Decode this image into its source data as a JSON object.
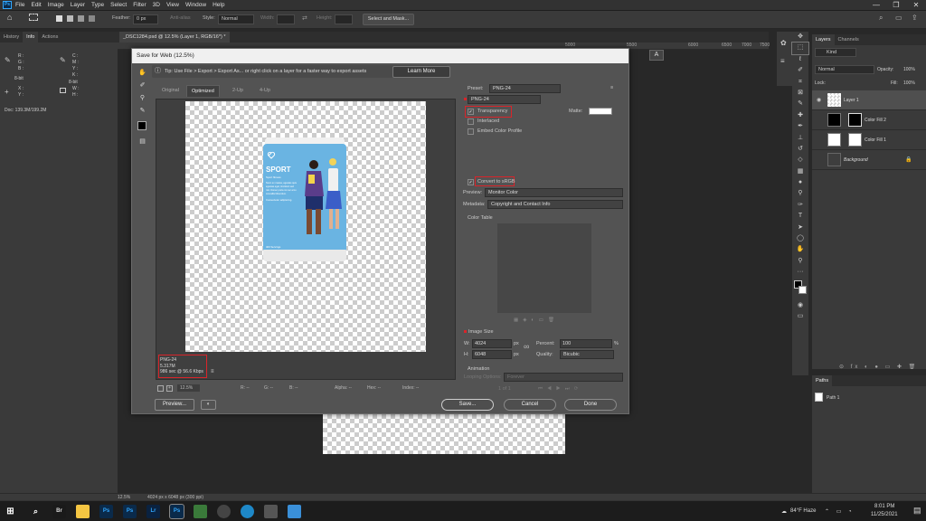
{
  "menubar": {
    "app_icon": "Ps",
    "items": [
      "File",
      "Edit",
      "Image",
      "Layer",
      "Type",
      "Select",
      "Filter",
      "3D",
      "View",
      "Window",
      "Help"
    ]
  },
  "options": {
    "feather_label": "Feather:",
    "feather_value": "0 px",
    "antialias_label": "Anti-alias",
    "style_label": "Style:",
    "style_value": "Normal",
    "width_label": "Width:",
    "height_label": "Height:",
    "select_mask": "Select and Mask..."
  },
  "left_panel": {
    "tabs": [
      "History",
      "Info",
      "Actions"
    ],
    "active_tab": "Info",
    "r": "R :",
    "g": "G :",
    "b": "B :",
    "bit": "8-bit",
    "c": "C :",
    "m": "M :",
    "y": "Y :",
    "k": "K :",
    "bit2": "8-bit",
    "x": "X :",
    "y2": "Y :",
    "w": "W :",
    "h": "H :",
    "doc": "Doc: 139.3M/199.2M"
  },
  "document": {
    "tab": "_DSC1284.psd @ 12.5% (Layer 1, RGB/16*) *",
    "ruler": [
      "5000",
      "5500",
      "6000",
      "6500",
      "7000",
      "7500"
    ]
  },
  "dialog": {
    "title": "Save for Web (12.5%)",
    "tip": "Tip: Use File > Export > Export As...  or right click on a layer for a faster way to export assets",
    "learn_more": "Learn More",
    "view_tabs": [
      "Original",
      "Optimized",
      "2-Up",
      "4-Up"
    ],
    "active_view": "Optimized",
    "product": {
      "brand": "SPORT",
      "subtitle": "Sport fitness",
      "desc1": "Nunc ex massa, egestas quis",
      "desc2": "egestas eget, tincidunt sed",
      "desc3": "nisl. Donec porta mi nec arcu",
      "desc4": "convallis bibendum.",
      "desc5": "Consectetur adipiscing.",
      "net": "400 Servings"
    },
    "preview_info": {
      "format": "PNG-24",
      "size": "5.317M",
      "time": "986 sec @ 56.6 Kbps"
    },
    "bottom": {
      "zoom": "12.5%",
      "r": "R: --",
      "g": "G: --",
      "b": "B: --",
      "alpha": "Alpha: --",
      "hex": "Hex: --",
      "index": "Index: --"
    },
    "buttons": {
      "preview": "Preview...",
      "save": "Save...",
      "cancel": "Cancel",
      "done": "Done"
    },
    "settings": {
      "preset_label": "Preset:",
      "preset_value": "PNG-24",
      "format_value": "PNG-24",
      "transparency": "Transparency",
      "matte_label": "Matte:",
      "interlaced": "Interlaced",
      "embed_profile": "Embed Color Profile",
      "convert_srgb": "Convert to sRGB",
      "preview_label": "Preview:",
      "preview_value": "Monitor Color",
      "metadata_label": "Metadata:",
      "metadata_value": "Copyright and Contact Info",
      "color_table": "Color Table",
      "image_size": "Image Size",
      "w_label": "W:",
      "w_value": "4024",
      "h_label": "H:",
      "h_value": "6048",
      "px": "px",
      "percent_label": "Percent:",
      "percent_value": "100",
      "percent_unit": "%",
      "quality_label": "Quality:",
      "quality_value": "Bicubic",
      "animation": "Animation",
      "looping_label": "Looping Options:",
      "looping_value": "Forever",
      "frame_counter": "1 of 1"
    }
  },
  "layers_panel": {
    "tabs": [
      "Layers",
      "Channels"
    ],
    "kind": "Kind",
    "blend": "Normal",
    "opacity_label": "Opacity:",
    "opacity": "100%",
    "lock_label": "Lock:",
    "fill_label": "Fill:",
    "fill": "100%",
    "layers": [
      "Layer 1",
      "Color Fill 2",
      "Color Fill 1",
      "Background"
    ]
  },
  "paths_panel": {
    "tab": "Paths",
    "item": "Path 1"
  },
  "statusbar": {
    "zoom": "12.5%",
    "dims": "4024 px x 6048 px (300 ppi)"
  },
  "taskbar": {
    "weather": "84°F  Haze",
    "time": "8:01 PM",
    "date": "11/25/2021"
  }
}
